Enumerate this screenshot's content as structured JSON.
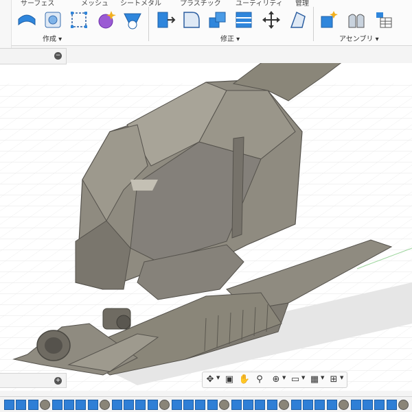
{
  "toolbar": {
    "tabs": [
      "サーフェス",
      "メッシュ",
      "シートメタル",
      "プラスチック",
      "ユーティリティ",
      "管理"
    ],
    "groups": {
      "create_label": "作成 ▾",
      "modify_label": "修正 ▾",
      "assemble_label": "アセンブリ ▾"
    },
    "create_tools": [
      "extrude-surface-icon",
      "box-icon",
      "sketch-rectangle-icon",
      "form-sphere-icon",
      "loft-icon"
    ],
    "modify_tools": [
      "press-pull-icon",
      "fillet-icon",
      "combine-icon",
      "shell-icon",
      "move-icon",
      "draft-icon"
    ],
    "assemble_tools": [
      "new-component-icon",
      "joint-icon",
      "bom-icon"
    ]
  },
  "browser": {
    "collapse_symbol": "−"
  },
  "comments": {
    "expand_symbol": "+"
  },
  "nav_bar": {
    "tools": [
      "orbit-icon",
      "look-at-icon",
      "pan-icon",
      "zoom-icon",
      "fit-icon",
      "display-settings-icon",
      "grid-icon",
      "viewports-icon"
    ]
  },
  "timeline": {
    "item_count": 34,
    "highlighted_index": 28,
    "colors": {
      "feature": "#2f7fd6",
      "highlight": "#f5ea26",
      "body": "#8a8578"
    }
  },
  "model": {
    "fill_main": "#8f8b80",
    "fill_light": "#a8a498",
    "fill_dark": "#6f6b62",
    "shadow": "#d8d8d8"
  }
}
